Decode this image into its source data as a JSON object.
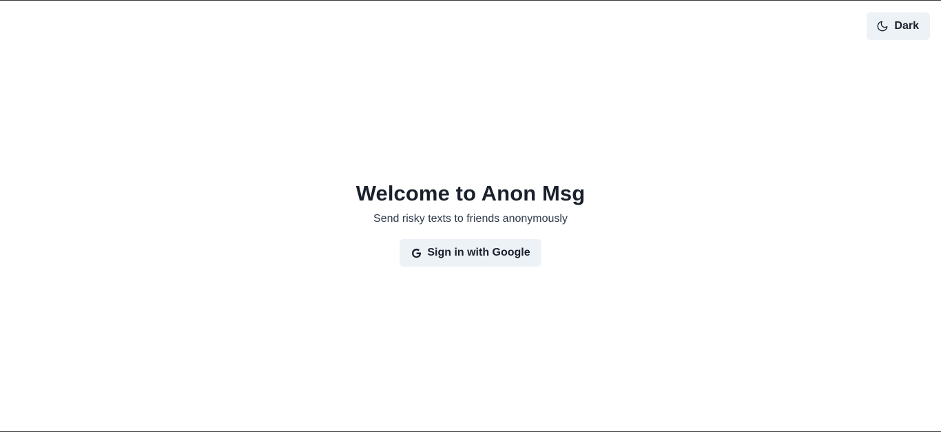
{
  "header": {
    "theme_toggle": {
      "label": "Dark",
      "icon": "moon-icon"
    }
  },
  "hero": {
    "title": "Welcome to Anon Msg",
    "subtitle": "Send risky texts to friends anonymously",
    "sign_in": {
      "label": "Sign in with Google",
      "icon": "google-icon"
    }
  },
  "colors": {
    "background": "#ffffff",
    "button_bg": "#edf2f7",
    "text": "#1a202c"
  }
}
